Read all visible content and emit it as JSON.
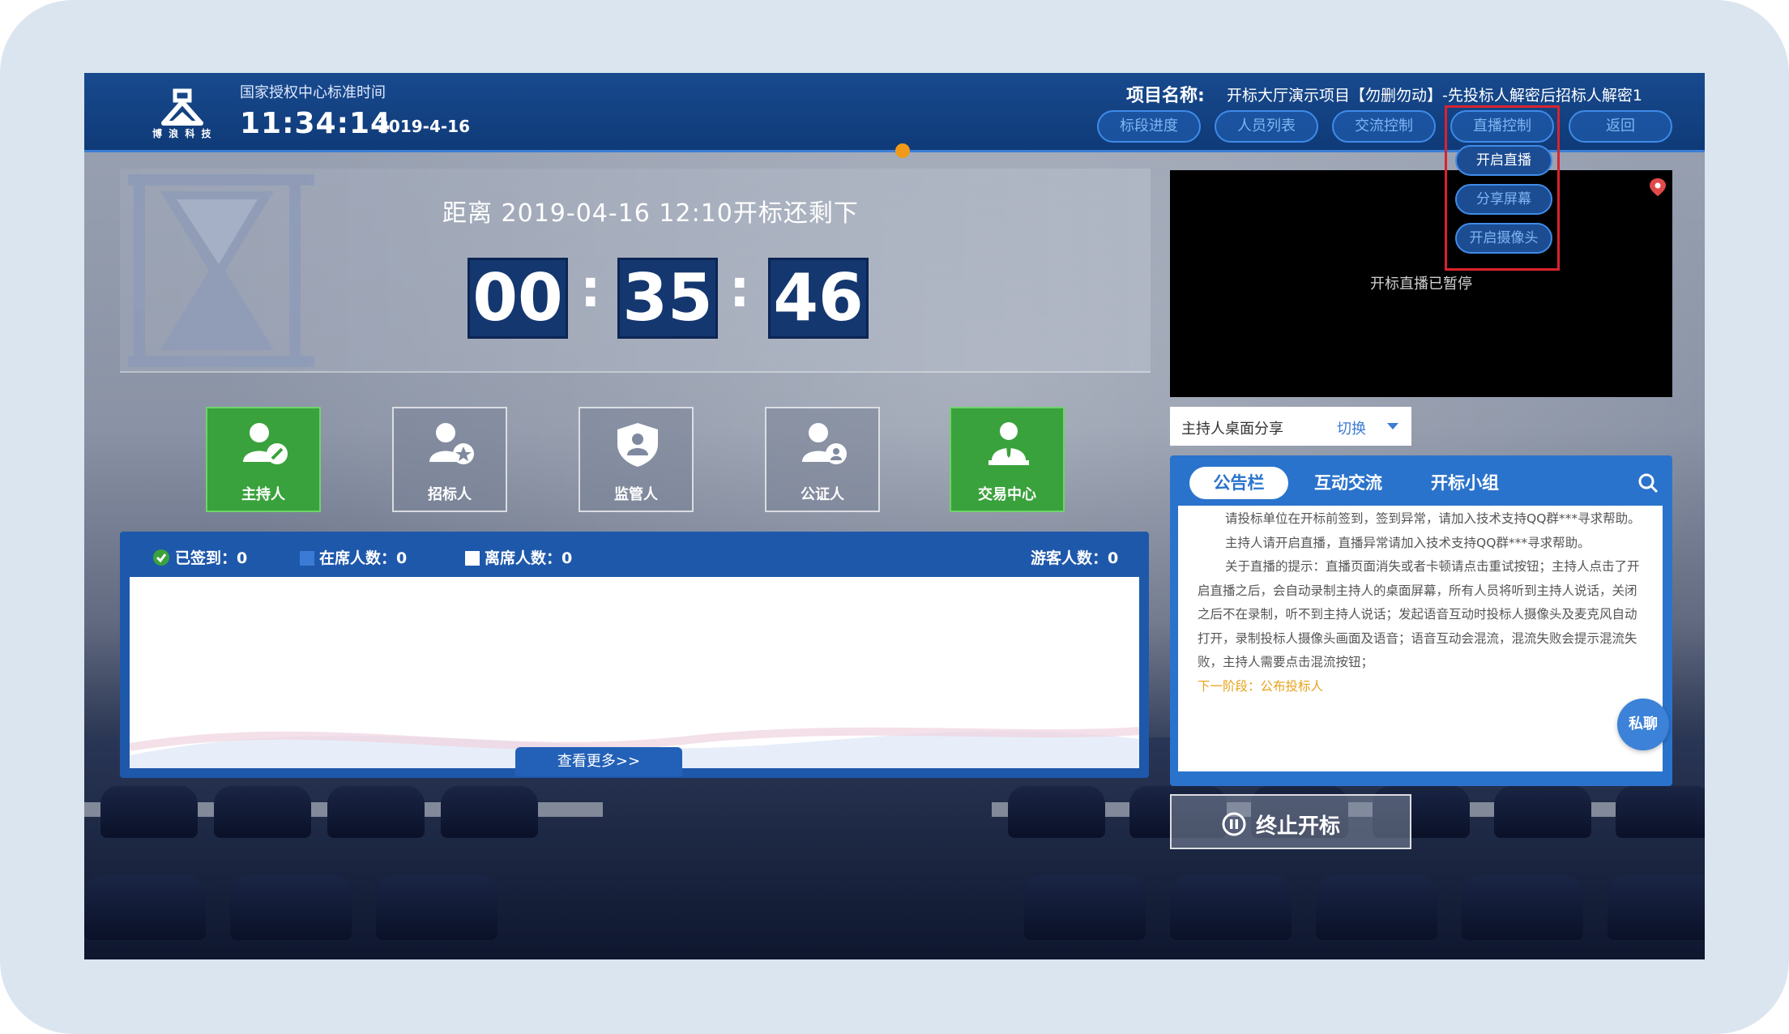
{
  "header": {
    "logo_text": "博 浪 科 技",
    "time_caption": "国家授权中心标准时间",
    "clock": "11:34:14",
    "date": "2019-4-16",
    "project_label": "项目名称:",
    "project_name": "开标大厅演示项目【勿删勿动】-先投标人解密后招标人解密1",
    "nav": [
      "标段进度",
      "人员列表",
      "交流控制",
      "直播控制",
      "返回"
    ]
  },
  "live_dropdown": {
    "items": [
      "开启直播",
      "分享屏幕",
      "开启摄像头"
    ]
  },
  "countdown": {
    "title": "距离 2019-04-16 12:10开标还剩下",
    "hours": "00",
    "minutes": "35",
    "seconds": "46"
  },
  "roles": [
    {
      "label": "主持人",
      "active": true,
      "icon": "host-icon"
    },
    {
      "label": "招标人",
      "active": false,
      "icon": "tenderer-icon"
    },
    {
      "label": "监管人",
      "active": false,
      "icon": "supervisor-icon"
    },
    {
      "label": "公证人",
      "active": false,
      "icon": "notary-icon"
    },
    {
      "label": "交易中心",
      "active": true,
      "icon": "trading-center-icon"
    }
  ],
  "attendance": {
    "signed": "已签到：0",
    "present": "在席人数：0",
    "absent": "离席人数：0",
    "visitors": "游客人数：0",
    "more": "查看更多>>"
  },
  "video": {
    "status": "开标直播已暂停"
  },
  "share": {
    "label": "主持人桌面分享",
    "switch": "切换"
  },
  "notice": {
    "tabs": [
      "公告栏",
      "互动交流",
      "开标小组"
    ],
    "paragraphs": [
      "请投标单位在开标前签到，签到异常，请加入技术支持QQ群***寻求帮助。",
      "主持人请开启直播，直播异常请加入技术支持QQ群***寻求帮助。",
      "关于直播的提示：直播页面消失或者卡顿请点击重试按钮；主持人点击了开启直播之后，会自动录制主持人的桌面屏幕，所有人员将听到主持人说话，关闭之后不在录制，听不到主持人说话；发起语音互动时投标人摄像头及麦克风自动打开，录制投标人摄像头画面及语音；语音互动会混流，混流失败会提示混流失败，主持人需要点击混流按钮；"
    ],
    "next_stage": "下一阶段：公布投标人",
    "chat_button": "私聊"
  },
  "stop_button": "终止开标",
  "colors": {
    "header_blue": "#124384",
    "accent_blue": "#2a73cc",
    "active_green": "#3aa23c",
    "highlight_red": "#d9232d",
    "orange_dot": "#f19a1a"
  }
}
